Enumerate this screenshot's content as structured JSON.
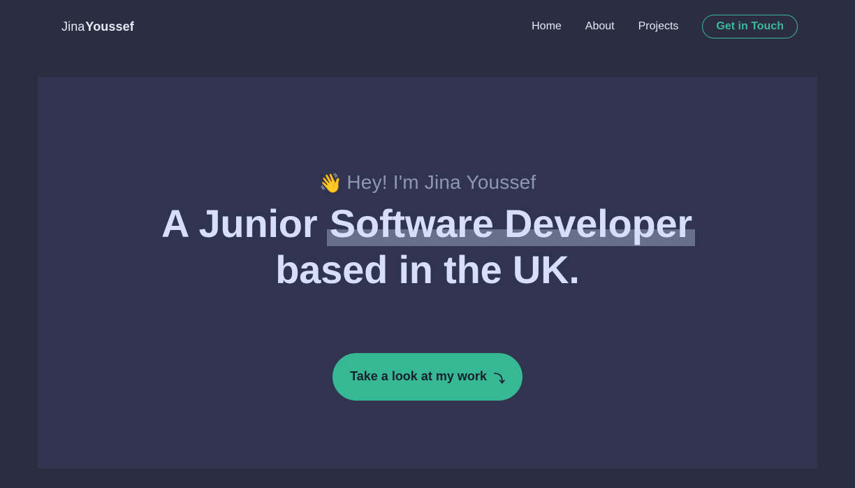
{
  "header": {
    "logo": {
      "first": "Jina",
      "last": "Youssef"
    },
    "nav": [
      {
        "label": "Home"
      },
      {
        "label": "About"
      },
      {
        "label": "Projects"
      }
    ],
    "cta_label": "Get in Touch"
  },
  "hero": {
    "greeting_text": "Hey! I'm Jina Youssef",
    "headline": {
      "prefix": "A Junior ",
      "highlight": "Software Developer",
      "line2": "based in the UK."
    },
    "button_label": "Take a look at my work",
    "icons": {
      "greeting": "wave-icon",
      "button": "arrow-down-right-icon"
    }
  },
  "colors": {
    "page_bg": "#2b2d42",
    "card_bg": "#30344f",
    "accent": "#3aba9a",
    "text": "#d6def9",
    "muted": "#8f96b3"
  }
}
